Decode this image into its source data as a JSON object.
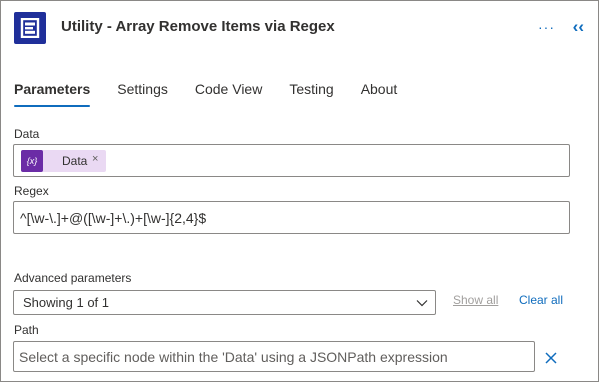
{
  "header": {
    "title": "Utility - Array Remove Items via Regex",
    "more_icon": "more-ellipsis-icon",
    "collapse_icon": "double-chevron-left-icon",
    "more_glyph": "···",
    "collapse_glyph": "‹‹",
    "app_icon": "utility-connector-icon",
    "app_color": "#1f2f9a"
  },
  "tabs": [
    {
      "label": "Parameters",
      "active": true
    },
    {
      "label": "Settings",
      "active": false
    },
    {
      "label": "Code View",
      "active": false
    },
    {
      "label": "Testing",
      "active": false
    },
    {
      "label": "About",
      "active": false
    }
  ],
  "data_field": {
    "label": "Data",
    "token": {
      "icon_text": "{x}",
      "label": "Data",
      "remove": "×",
      "icon": "variable-icon"
    }
  },
  "regex_field": {
    "label": "Regex",
    "value": "^[\\w-\\.]+@([\\w-]+\\.)+[\\w-]{2,4}$"
  },
  "advanced": {
    "label": "Advanced parameters",
    "dropdown_value": "Showing 1 of 1",
    "show_all": "Show all",
    "clear_all": "Clear all"
  },
  "path_field": {
    "label": "Path",
    "placeholder": "Select a specific node within the 'Data' using a JSONPath expression",
    "remove_icon": "close-icon"
  },
  "colors": {
    "accent": "#0f6cbd",
    "token_bg": "#ead9f3",
    "token_icon_bg": "#6b2ca6"
  }
}
